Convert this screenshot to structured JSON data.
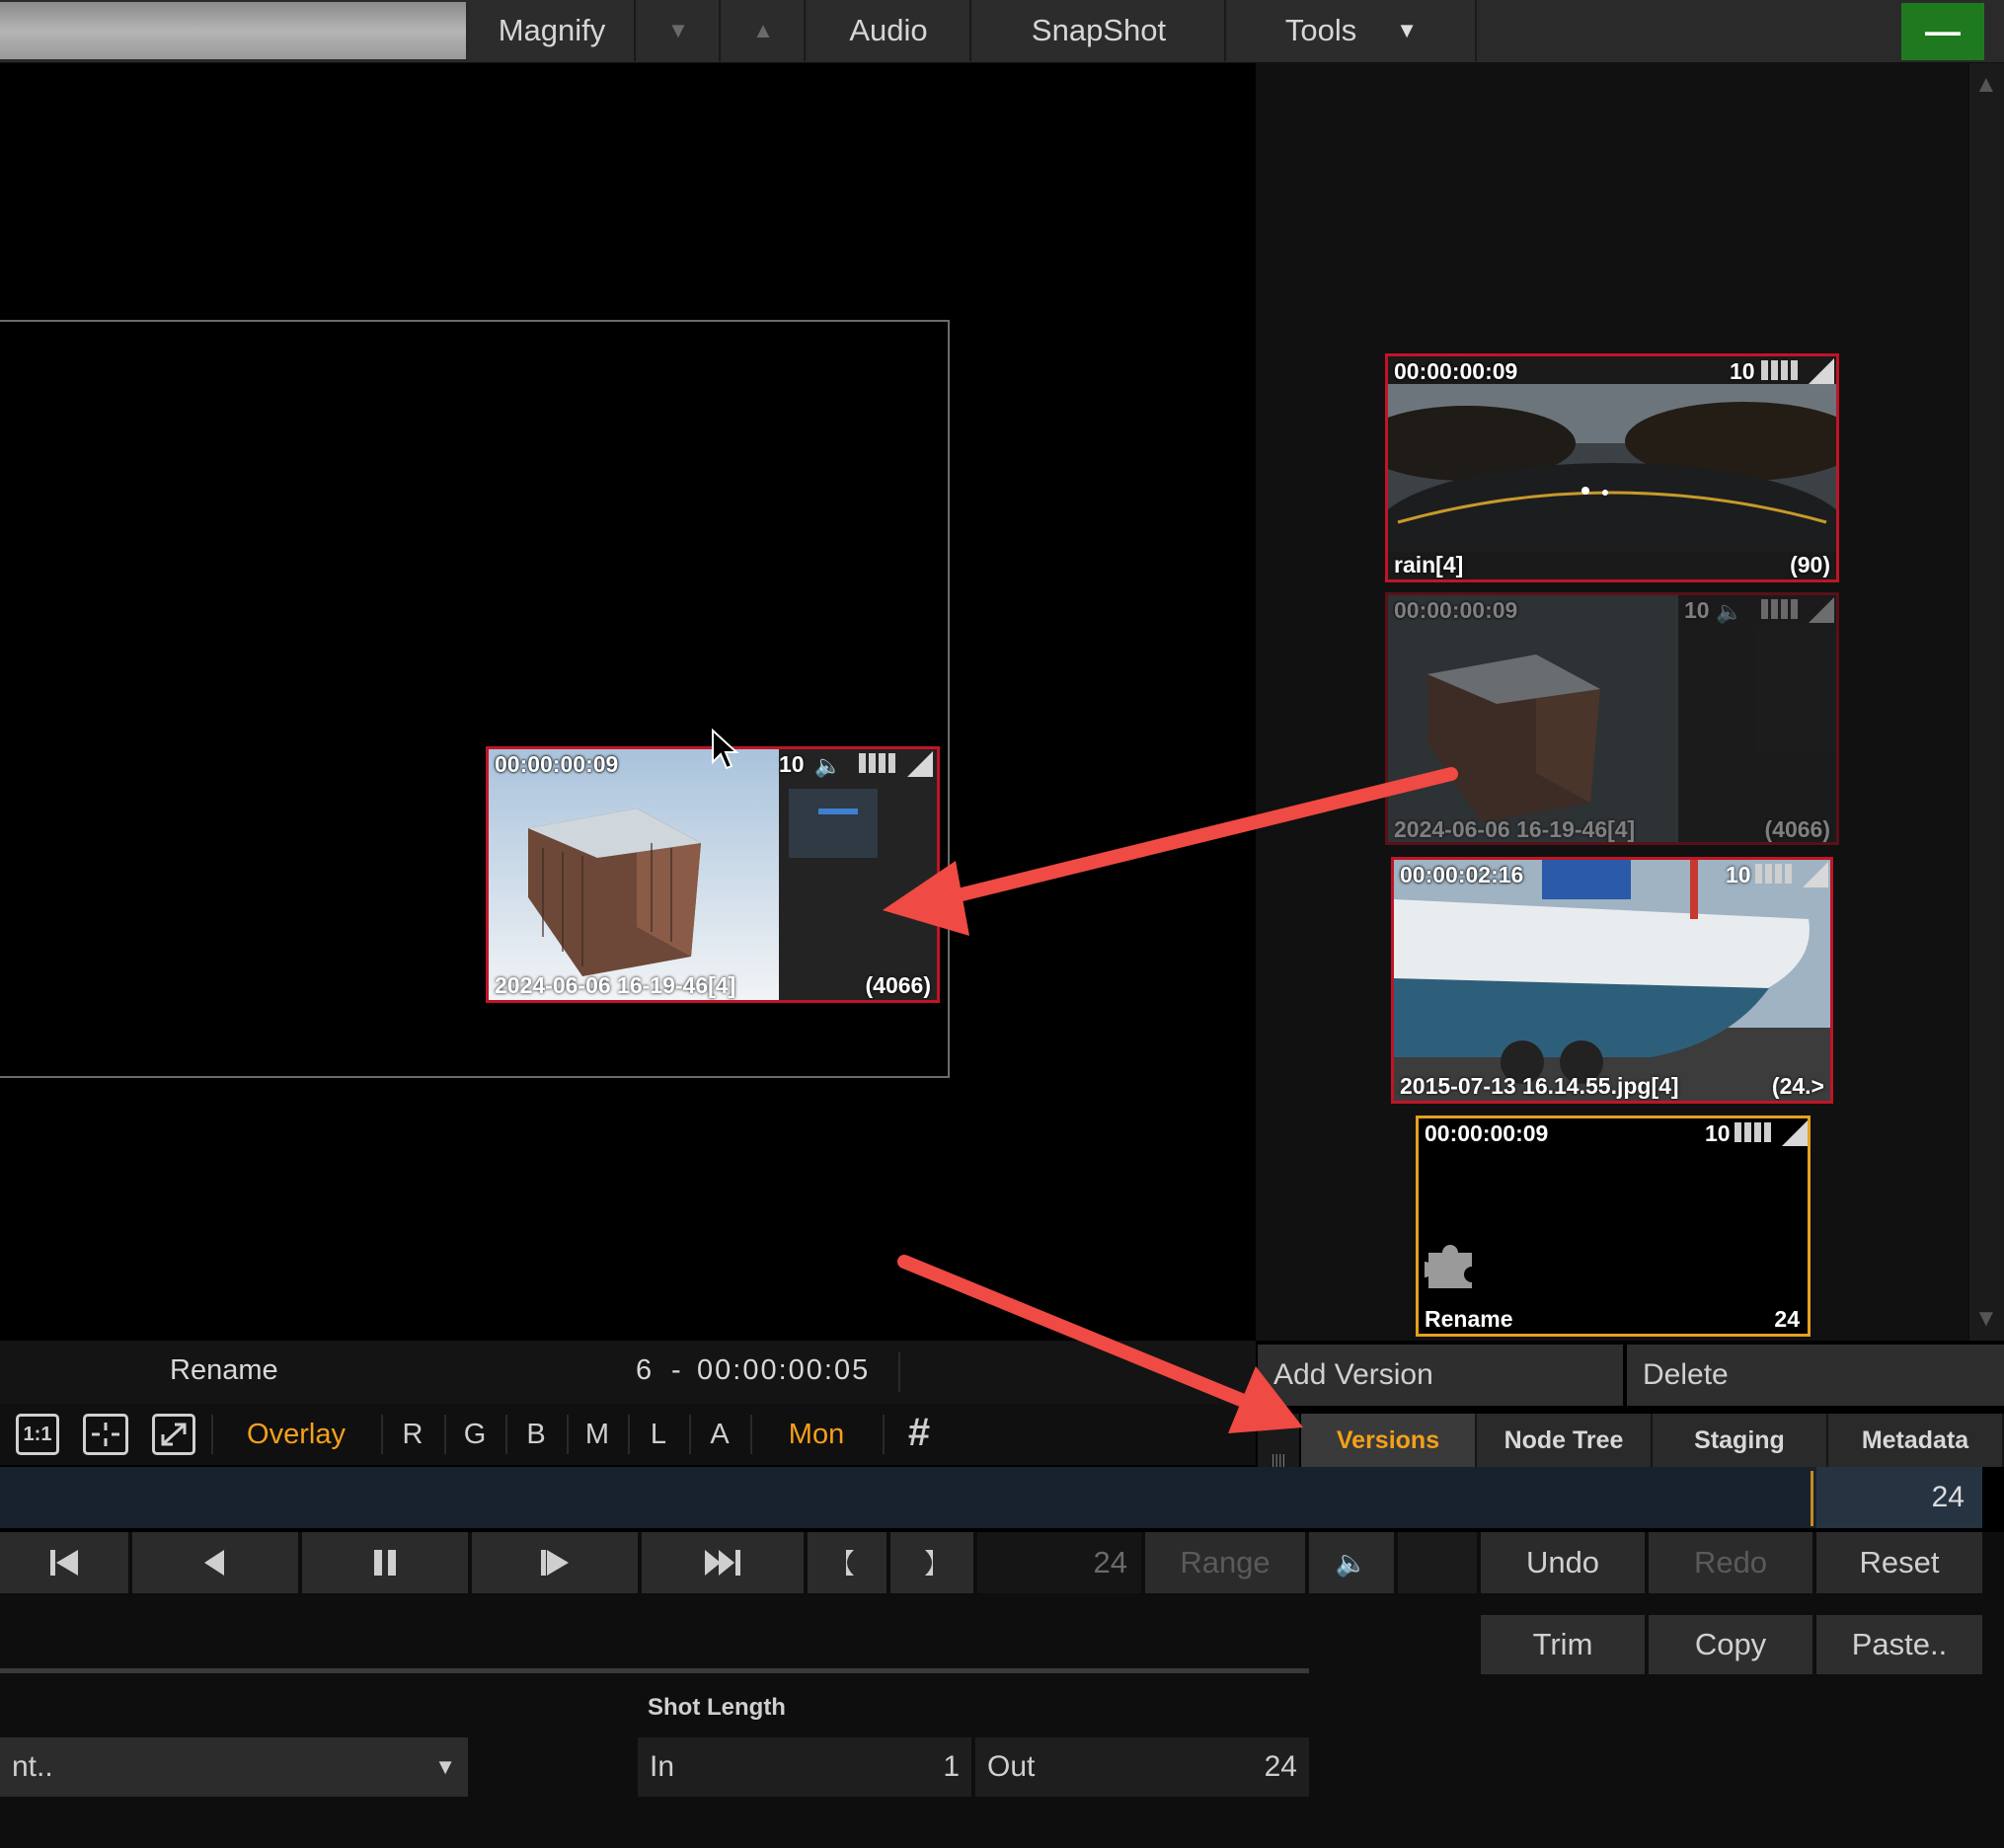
{
  "toolbar": {
    "magnify_label": "Magnify",
    "audio_label": "Audio",
    "snapshot_label": "SnapShot",
    "tools_label": "Tools",
    "down_arrow": "▼",
    "up_arrow": "▲",
    "minimize_symbol": "—"
  },
  "viewer_clip": {
    "timecode": "00:00:00:09",
    "ten": "10",
    "name": "2024-06-06 16-19-46[4]",
    "count": "(4066)"
  },
  "versions": [
    {
      "timecode": "00:00:00:09",
      "ten": "10",
      "name": "rain[4]",
      "count": "(90)"
    },
    {
      "timecode": "00:00:00:09",
      "ten": "10",
      "name": "2024-06-06 16-19-46[4]",
      "count": "(4066)"
    },
    {
      "timecode": "00:00:02:16",
      "ten": "10",
      "name": "2015-07-13 16.14.55.jpg[4]",
      "count": "(24.>"
    },
    {
      "timecode": "00:00:00:09",
      "ten": "10",
      "name": "Rename",
      "count": "24"
    }
  ],
  "panel": {
    "add_version": "Add Version",
    "delete": "Delete",
    "tabs": [
      "Versions",
      "Node Tree",
      "Staging",
      "Metadata"
    ]
  },
  "infobar": {
    "clip_name": "Rename",
    "shot_num": "6",
    "dash": "-",
    "timecode": "00:00:00:05"
  },
  "viewer_tools": {
    "one_to_one": "1:1",
    "overlay": "Overlay",
    "channels": [
      "R",
      "G",
      "B",
      "M",
      "L",
      "A"
    ],
    "mon": "Mon",
    "grid_symbol": "#"
  },
  "timeline": {
    "end_frame": "24"
  },
  "transport": {
    "frame_field": "24",
    "range": "Range",
    "undo": "Undo",
    "redo": "Redo",
    "reset": "Reset"
  },
  "edit": {
    "trim": "Trim",
    "copy": "Copy",
    "paste": "Paste..",
    "shot_length_label": "Shot Length",
    "dropdown_value": "nt..",
    "in_label": "In",
    "in_value": "1",
    "out_label": "Out",
    "out_value": "24"
  },
  "colors": {
    "accent": "#f5a01a",
    "selection_red": "#c01526",
    "arrow_red": "#ef4a43",
    "minimize_green": "#1f7a1f"
  }
}
